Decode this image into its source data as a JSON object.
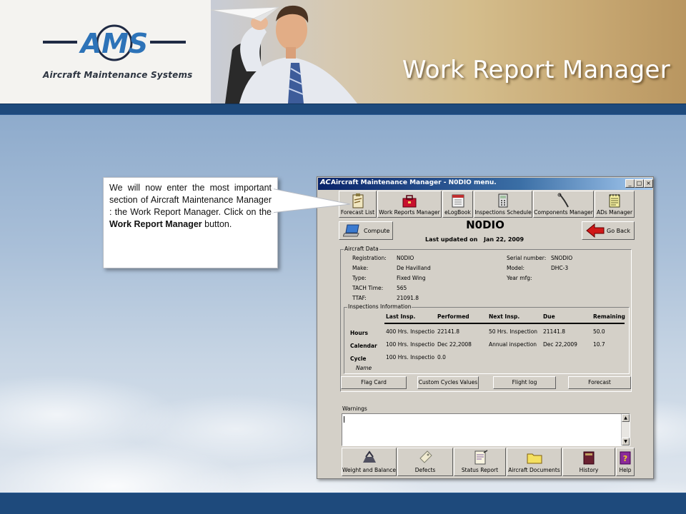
{
  "slide": {
    "title": "Work Report Manager",
    "logo_text": "AMS",
    "logo_tagline": "Aircraft Maintenance Systems",
    "callout_text_1": "We will now enter the most important section of Aircraft Maintenance Manager : the Work Report Manager. Click on the ",
    "callout_text_bold": "Work Report Manager",
    "callout_text_2": " button."
  },
  "window": {
    "title": "Aircraft Maintenance Manager - N0DIO menu.",
    "controls": {
      "minimize": "_",
      "maximize": "□",
      "close": "×"
    }
  },
  "toolbar": {
    "items": [
      {
        "label": "Forecast List",
        "icon": "clipboard-icon"
      },
      {
        "label": "Work Reports Manager",
        "icon": "toolbox-icon"
      },
      {
        "label": "eLogBook",
        "icon": "calendar-book-icon"
      },
      {
        "label": "Inspections Schedule",
        "icon": "calculator-icon"
      },
      {
        "label": "Components Manager",
        "icon": "wrench-icon"
      },
      {
        "label": "ADs Manager",
        "icon": "notepad-icon"
      }
    ]
  },
  "actions": {
    "compute_label": "Compute",
    "go_back_label": "Go Back"
  },
  "aircraft": {
    "registration_display": "N0DIO",
    "last_updated_label": "Last updated on",
    "last_updated_value": "Jan 22, 2009"
  },
  "aircraft_data": {
    "group_title": "Aircraft Data",
    "left": [
      {
        "label": "Registration:",
        "value": "N0DIO"
      },
      {
        "label": "Make:",
        "value": "De Havilland"
      },
      {
        "label": "Type:",
        "value": "Fixed Wing"
      },
      {
        "label": "TACH Time:",
        "value": "565"
      },
      {
        "label": "TTAF:",
        "value": "21091.8"
      }
    ],
    "right": [
      {
        "label": "Serial number:",
        "value": "SNODIO"
      },
      {
        "label": "Model:",
        "value": "DHC-3"
      },
      {
        "label": "Year mfg:",
        "value": ""
      }
    ]
  },
  "inspections": {
    "group_title": "Inspections Information",
    "headers": [
      "Last Insp.",
      "Performed",
      "Next Insp.",
      "Due",
      "Remaining"
    ],
    "rows": [
      {
        "label": "Hours",
        "cells": [
          "400 Hrs. Inspectio",
          "22141.8",
          "50 Hrs. Inspection",
          "21141.8",
          "50.0"
        ]
      },
      {
        "label": "Calendar",
        "cells": [
          "100 Hrs. Inspectio",
          "Dec 22,2008",
          "Annual inspection",
          "Dec 22,2009",
          "10.7"
        ]
      },
      {
        "label": "Cycle",
        "cells": [
          "100 Hrs. Inspectio",
          "0.0",
          "",
          "",
          ""
        ]
      }
    ],
    "name_label": "Name"
  },
  "bottom_buttons": [
    "Flag Card",
    "Custom Cycles Values",
    "Flight log",
    "Forecast"
  ],
  "warnings": {
    "label": "Warnings",
    "value": ""
  },
  "footer_toolbar": {
    "items": [
      {
        "label": "Weight and Balance",
        "icon": "scale-icon"
      },
      {
        "label": "Defects",
        "icon": "tag-icon"
      },
      {
        "label": "Status Report",
        "icon": "report-icon"
      },
      {
        "label": "Aircraft Documents",
        "icon": "folder-icon"
      },
      {
        "label": "History",
        "icon": "book-icon"
      },
      {
        "label": "Help",
        "icon": "help-book-icon"
      }
    ]
  },
  "colors": {
    "title_bar": "#0a246a",
    "header_band": "#1e4a7c",
    "window_face": "#d4d0c8",
    "go_back_arrow": "#d01818"
  }
}
